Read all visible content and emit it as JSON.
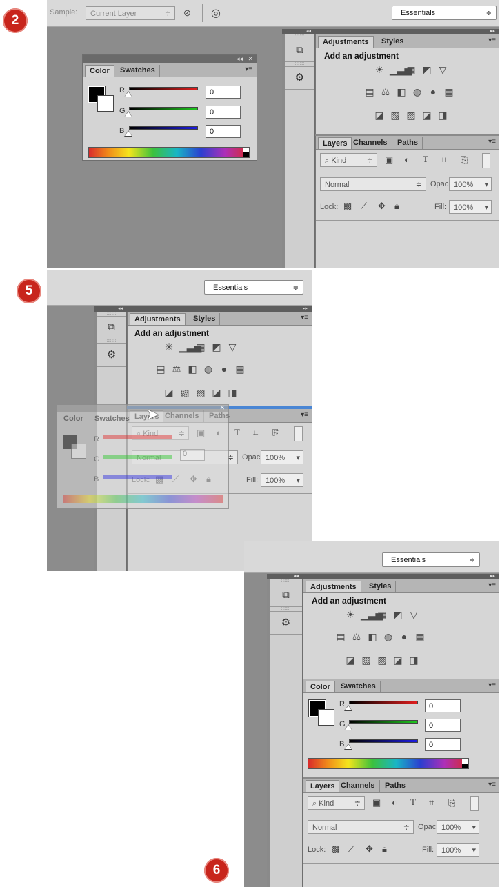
{
  "steps": {
    "step2": "2",
    "step5": "5",
    "step6": "6"
  },
  "options_bar": {
    "sample_label": "Sample:",
    "sample_value": "Current Layer",
    "sample_icon": "no-sample-icon",
    "target_icon": "target-icon"
  },
  "workspace": {
    "label": "Essentials"
  },
  "dock": {
    "collapse_icon": "double-chevron-left-icon",
    "expand_icon": "double-chevron-right-icon"
  },
  "icon_column": {
    "history_icon": "history-icon",
    "properties_icon": "properties-icon"
  },
  "adjustments": {
    "tabs": [
      "Adjustments",
      "Styles"
    ],
    "title": "Add an adjustment",
    "row1": [
      "☀",
      "▁▃▅",
      "▦",
      "◩",
      "▽"
    ],
    "row2": [
      "▤",
      "⚖",
      "◧",
      "◍",
      "●",
      "▦"
    ],
    "row3": [
      "◪",
      "▧",
      "▨",
      "◪",
      "◨"
    ],
    "icon_names": [
      "brightness-icon",
      "levels-icon",
      "curves-icon",
      "exposure-icon",
      "vibrance-icon",
      "hue-saturation-icon",
      "color-balance-icon",
      "black-white-icon",
      "photo-filter-icon",
      "channel-mixer-icon",
      "color-lookup-icon",
      "invert-icon",
      "posterize-icon",
      "threshold-icon",
      "selective-color-icon",
      "gradient-map-icon"
    ]
  },
  "color": {
    "tabs": [
      "Color",
      "Swatches"
    ],
    "channels": [
      {
        "label": "R",
        "value": "0"
      },
      {
        "label": "G",
        "value": "0"
      },
      {
        "label": "B",
        "value": "0"
      }
    ],
    "colors": {
      "r": "#e11e1e",
      "g": "#1ec81e",
      "b": "#1e1ee1",
      "fg": "#000000",
      "bg": "#ffffff"
    }
  },
  "layers": {
    "tabs": [
      "Layers",
      "Channels",
      "Paths"
    ],
    "kind_label": "Kind",
    "blend_mode": "Normal",
    "opacity_label": "Opacity:",
    "opacity_value": "100%",
    "lock_label": "Lock:",
    "fill_label": "Fill:",
    "fill_value": "100%"
  },
  "floating_panel": {
    "collapse": "◂◂",
    "close": "✕"
  }
}
